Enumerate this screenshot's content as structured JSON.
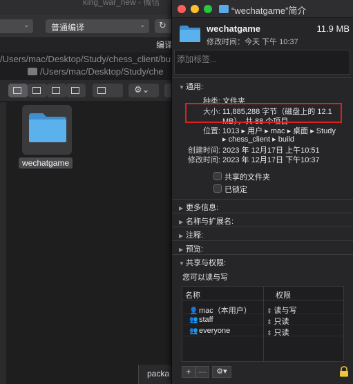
{
  "background": {
    "window_title": "king_war_new - 微信",
    "compile_select": "普通编译",
    "compile_label": "编译",
    "path_line1": "/Users/mac/Desktop/Study/chess_client/bu",
    "path_line2": "/Users/mac/Desktop/Study/che",
    "folder_name": "wechatgame",
    "bottom_tab": "packa"
  },
  "info": {
    "title": "“wechatgame”简介",
    "name": "wechatgame",
    "size_summary": "11.9 MB",
    "modified_summary": "修改时间：今天 下午 10:37",
    "tags_placeholder": "添加标签...",
    "general": {
      "header": "通用:",
      "kind_key": "种类:",
      "kind_val": "文件夹",
      "size_key": "大小:",
      "size_val_1": "11,885,288 字节（磁盘上的 12.1",
      "size_val_2": "MB），共 88 个项目",
      "where_key": "位置:",
      "where_val_1": "1013 ▸ 用户 ▸ mac ▸ 桌面 ▸ Study",
      "where_val_2": "▸ chess_client ▸ build",
      "created_key": "创建时间:",
      "created_val": "2023 年 12月17日 上午10:51",
      "modified_key": "修改时间:",
      "modified_val": "2023 年 12月17日 下午10:37",
      "shared_folder": "共享的文件夹",
      "locked": "已锁定"
    },
    "sections": {
      "more_info": "更多信息:",
      "name_ext": "名称与扩展名:",
      "comments": "注释:",
      "preview": "预览:",
      "sharing": "共享与权限:"
    },
    "permissions": {
      "note": "您可以读与写",
      "col_name": "名称",
      "col_priv": "权限",
      "rows": [
        {
          "name": "mac（本用户）",
          "priv": "读与写"
        },
        {
          "name": "staff",
          "priv": "只读"
        },
        {
          "name": "everyone",
          "priv": "只读"
        }
      ],
      "add": "+",
      "remove": "—",
      "gear": "⚙▾"
    }
  },
  "colors": {
    "folder_blue": "#5aa9e6",
    "highlight_red": "#e02020"
  }
}
